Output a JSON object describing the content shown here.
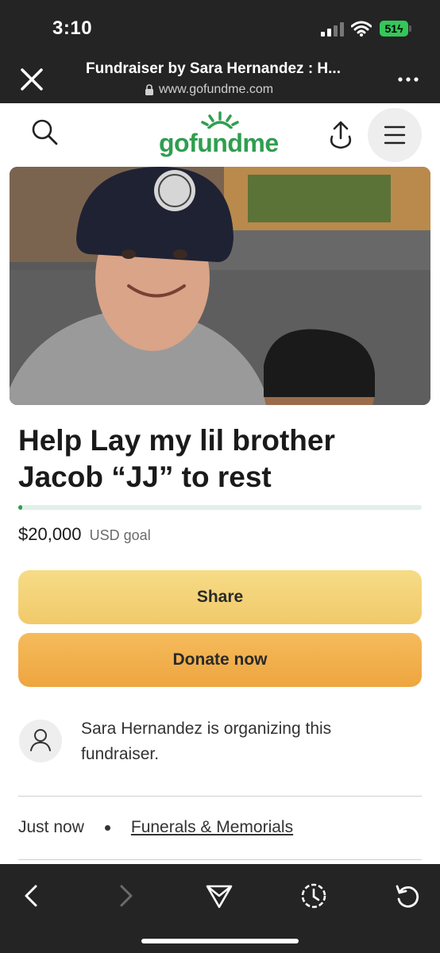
{
  "status_bar": {
    "time": "3:10",
    "battery": "51"
  },
  "browser": {
    "page_title": "Fundraiser by Sara Hernandez : H...",
    "url": "www.gofundme.com"
  },
  "site": {
    "logo": "gofundme",
    "brand_color": "#2f9e4f"
  },
  "campaign": {
    "title": "Help Lay my lil brother Jacob “JJ” to rest",
    "progress_fraction": 0.01,
    "goal_amount": "$20,000",
    "goal_suffix": "USD goal",
    "share_label": "Share",
    "donate_label": "Donate now",
    "organizer_text": "Sara Hernandez is organizing this fundraiser.",
    "posted": "Just now",
    "category": "Funerals & Memorials"
  },
  "icons": {
    "close": "close-icon",
    "more": "more-horizontal-icon",
    "search": "search-icon",
    "share": "share-up-icon",
    "menu": "hamburger-menu-icon",
    "user": "user-icon",
    "back": "chevron-left-icon",
    "forward": "chevron-right-icon",
    "send": "send-icon",
    "timer": "timer-icon",
    "reload": "reload-icon"
  }
}
